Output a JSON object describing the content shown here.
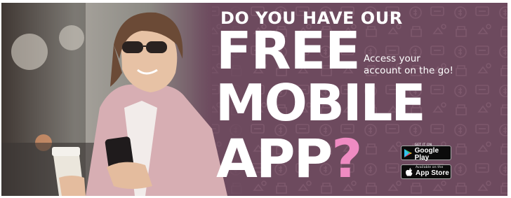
{
  "banner": {
    "headline_line1": "DO YOU HAVE OUR",
    "headline_line2": "FREE",
    "headline_line3": "MOBILE",
    "headline_line4": "APP",
    "question_mark": "?",
    "subtext_line1": "Access your",
    "subtext_line2": "account on the go!"
  },
  "badges": {
    "google_play": {
      "small": "GET IT ON",
      "big": "Google Play",
      "icon": "google-play-icon"
    },
    "app_store": {
      "small": "Available on the",
      "big": "App Store",
      "icon": "apple-icon"
    }
  },
  "colors": {
    "background": "#6d4a5e",
    "pattern": "#7d586c",
    "headline": "#ffffff",
    "accent": "#ef8bc2",
    "badge": "#0b0b0b"
  }
}
